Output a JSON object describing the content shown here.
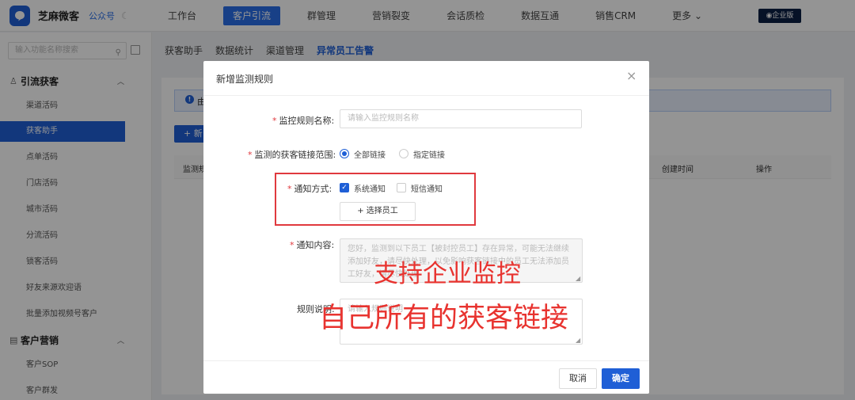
{
  "topbar": {
    "brand": "芝麻微客",
    "brand_sub": "公众号",
    "nav": [
      "工作台",
      "客户引流",
      "群管理",
      "营销裂变",
      "会话质检",
      "数据互通",
      "销售CRM",
      "更多 ⌄"
    ],
    "nav_active_index": 1,
    "enterprise_label": "◉企业版"
  },
  "sidebar": {
    "search_placeholder": "输入功能名称搜索",
    "groups": [
      {
        "label": "引流获客",
        "icon": "user-icon"
      },
      {
        "label": "客户营销",
        "icon": "list-icon"
      }
    ],
    "items": [
      "渠道活码",
      "获客助手",
      "点单活码",
      "门店活码",
      "城市活码",
      "分流活码",
      "锁客活码",
      "好友来源欢迎语",
      "批量添加视频号客户"
    ],
    "items2": [
      "客户SOP",
      "客户群发"
    ],
    "active_item": "获客助手"
  },
  "content": {
    "tabs": [
      "获客助手",
      "数据统计",
      "渠道管理",
      "异常员工告警"
    ],
    "active_tab": "异常员工告警",
    "info_text": "由",
    "new_button": "+ 新",
    "columns": [
      "监测规",
      "创建时间",
      "操作"
    ]
  },
  "modal": {
    "title": "新增监测规则",
    "close": "×",
    "rule_name_label": "监控规则名称:",
    "rule_name_placeholder": "请输入监控规则名称",
    "range_label": "监测的获客链接范围:",
    "range_options": [
      "全部链接",
      "指定链接"
    ],
    "range_selected": "全部链接",
    "notify_label": "通知方式:",
    "notify_options": [
      "系统通知",
      "短信通知"
    ],
    "notify_checked": [
      "系统通知"
    ],
    "select_staff_button": "+ 选择员工",
    "content_label": "通知内容:",
    "content_text": "您好，监测到以下员工【被封控员工】存在异常，可能无法继续添加好友，请尽快处理，以免影响获客链接中的员工无法添加员工好友，请尽快处理",
    "desc_label": "规则说明:",
    "desc_placeholder": "请输入规则说明",
    "cancel": "取消",
    "ok": "确定"
  },
  "annotation": {
    "line1": "支持企业监控",
    "line2": "自己所有的获客链接",
    "color": "#e8332f"
  }
}
